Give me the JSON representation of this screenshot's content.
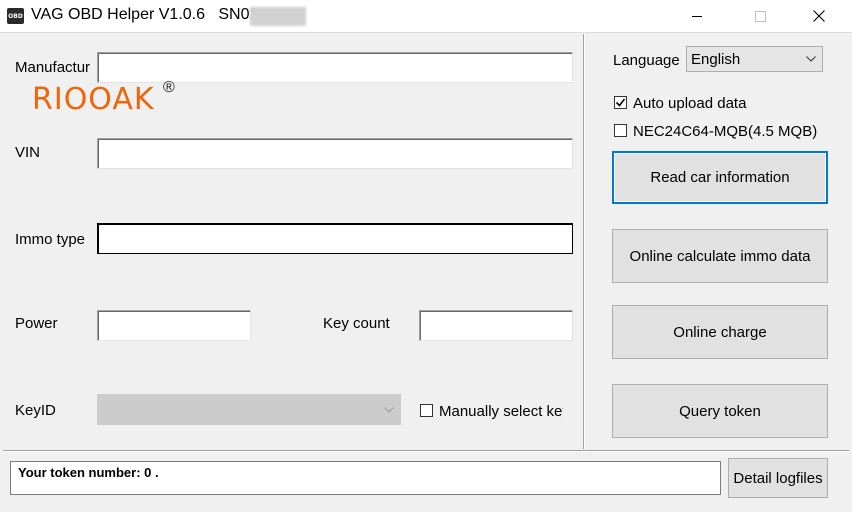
{
  "window": {
    "title": "VAG OBD Helper V1.0.6",
    "serial_prefix": "SN01",
    "icon_text": "OBD"
  },
  "left": {
    "manufacturer_label": "Manufactur",
    "vin_label": "VIN",
    "immo_type_label": "Immo type",
    "power_label": "Power",
    "key_count_label": "Key count",
    "keyid_label": "KeyID",
    "manually_select_key_label": "Manually select key",
    "manually_select_key_checked": false
  },
  "logo": {
    "text": "RIOOAK",
    "reg_mark": "®",
    "color": "#f0650a"
  },
  "right": {
    "language_label": "Language",
    "language_value": "English",
    "auto_upload_label": "Auto upload data",
    "auto_upload_checked": true,
    "nec_label": "NEC24C64-MQB(4.5 MQB)",
    "nec_checked": false,
    "read_car_info_label": "Read car information",
    "online_calc_label": "Online calculate immo data",
    "online_charge_label": "Online charge",
    "query_token_label": "Query token"
  },
  "bottom": {
    "token_text": "Your token number: 0 .",
    "detail_logfiles_label": "Detail logfiles"
  },
  "colors": {
    "focus_blue": "#0078d7",
    "background": "#f0f0f0"
  }
}
